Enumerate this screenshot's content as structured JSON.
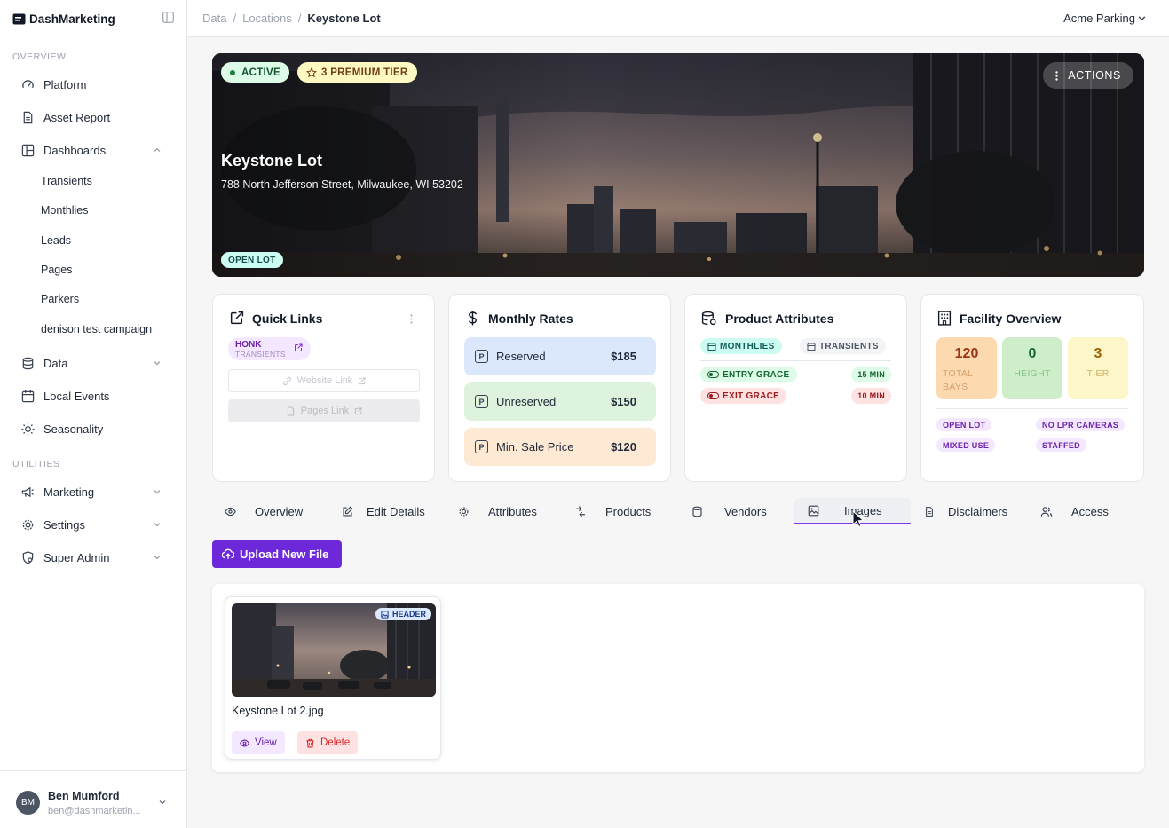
{
  "app": {
    "name": "DashMarketing"
  },
  "sidebar": {
    "sections": [
      "OVERVIEW",
      "UTILITIES"
    ],
    "items": {
      "platform": "Platform",
      "asset_report": "Asset Report",
      "dashboards": "Dashboards",
      "data": "Data",
      "local_events": "Local Events",
      "seasonality": "Seasonality",
      "marketing": "Marketing",
      "settings": "Settings",
      "super_admin": "Super Admin"
    },
    "dashboard_children": [
      "Transients",
      "Monthlies",
      "Leads",
      "Pages",
      "Parkers",
      "denison test campaign"
    ],
    "user": {
      "initials": "BM",
      "name": "Ben Mumford",
      "email": "ben@dashmarketin..."
    }
  },
  "header": {
    "breadcrumb": [
      "Data",
      "Locations",
      "Keystone Lot"
    ],
    "org": "Acme Parking"
  },
  "hero": {
    "status": "ACTIVE",
    "tier": "3 PREMIUM TIER",
    "actions": "ACTIONS",
    "title": "Keystone Lot",
    "address": "788 North Jefferson Street, Milwaukee, WI 53202",
    "lot_type": "OPEN LOT"
  },
  "quick_links": {
    "title": "Quick Links",
    "tag_main": "HONK",
    "tag_sub": "TRANSIENTS",
    "website": "Website Link",
    "pages": "Pages Link"
  },
  "monthly_rates": {
    "title": "Monthly Rates",
    "rates": [
      {
        "label": "Reserved",
        "amount": "$185",
        "color": "#dbe7fb"
      },
      {
        "label": "Unreserved",
        "amount": "$150",
        "color": "#ddf3de"
      },
      {
        "label": "Min. Sale Price",
        "amount": "$120",
        "color": "#fde9d4"
      }
    ]
  },
  "product_attributes": {
    "title": "Product Attributes",
    "monthlies": "MONTHLIES",
    "transients": "TRANSIENTS",
    "entry_grace": "ENTRY GRACE",
    "entry_value": "15 MIN",
    "exit_grace": "EXIT GRACE",
    "exit_value": "10 MIN"
  },
  "facility": {
    "title": "Facility Overview",
    "stats": [
      {
        "value": "120",
        "label": "TOTAL BAYS",
        "color": "#fdd9b0"
      },
      {
        "value": "0",
        "label": "HEIGHT",
        "color": "#cdeec9"
      },
      {
        "value": "3",
        "label": "TIER",
        "color": "#fdf6c8"
      }
    ],
    "tags": [
      "OPEN LOT",
      "NO LPR CAMERAS",
      "MIXED USE",
      "STAFFED"
    ]
  },
  "tabs": [
    "Overview",
    "Edit Details",
    "Attributes",
    "Products",
    "Vendors",
    "Images",
    "Disclaimers",
    "Access"
  ],
  "active_tab": "Images",
  "upload_label": "Upload New File",
  "image": {
    "header_badge": "HEADER",
    "filename": "Keystone Lot 2.jpg",
    "view": "View",
    "delete": "Delete"
  },
  "colors": {
    "accent": "#6d28d9",
    "active_green": "#dcfce7",
    "tier_yellow": "#fef9c3"
  }
}
